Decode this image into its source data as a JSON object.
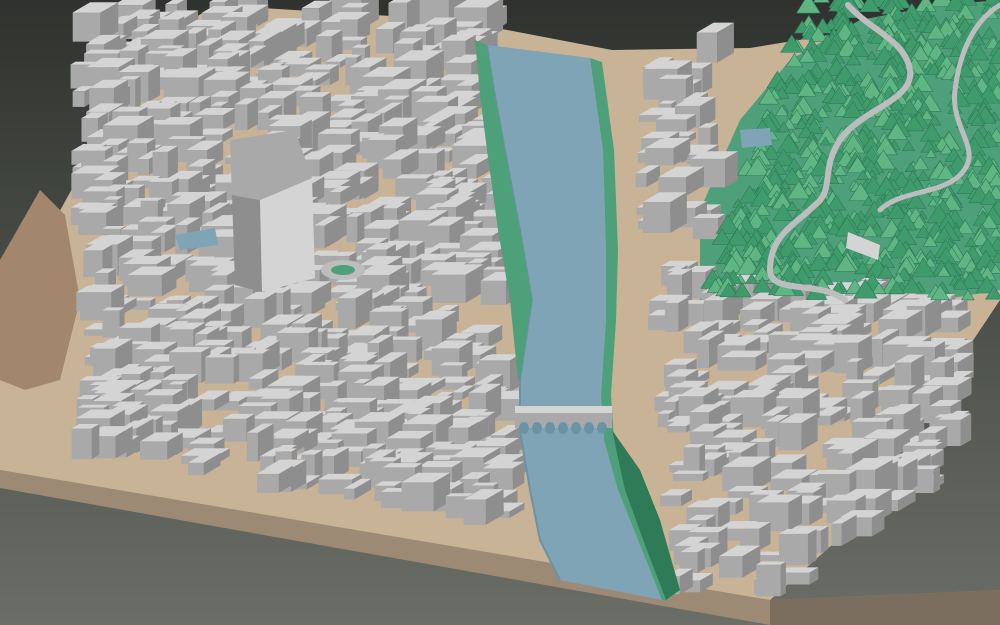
{
  "scene": {
    "kind": "3d-city-model",
    "colors": {
      "background_top": "#2f322e",
      "background_bottom": "#6a6e66",
      "terrain": "#c9b396",
      "terrain_side": "#9c8a74",
      "terrain_side_dark": "#7c6e5e",
      "building": "#d4d4d4",
      "building_shadow": "#a9a9a9",
      "building_dark": "#8e8e8e",
      "road": "#bdbdbd",
      "water": "#7fa4b6",
      "water_edge": "#6b93a6",
      "green": "#4ea07a",
      "green_dark": "#2f7b57",
      "tree": "#3f9a6c",
      "tree_light": "#5fb583",
      "cliff": "#a3876d"
    },
    "elements": [
      "terrain-block",
      "river",
      "bridge",
      "old-town-buildings",
      "tower-block",
      "roundabout",
      "forested-hill",
      "winding-road",
      "riverbank-green"
    ]
  }
}
